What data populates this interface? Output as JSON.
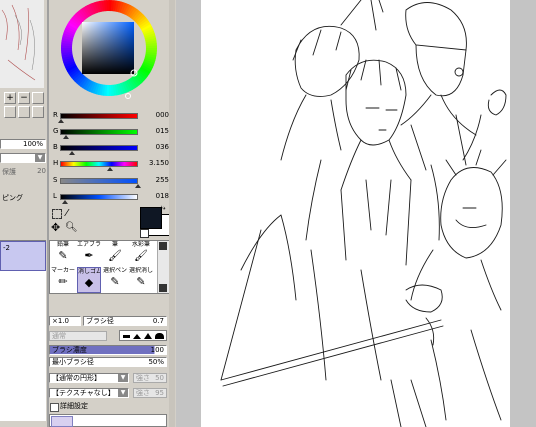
{
  "layer_panel": {
    "opacity_value": "100%",
    "mode_value": "",
    "checkbox_a": "保護",
    "checkbox_b": "20",
    "option_label": "ピング",
    "layer_item_label": "-2"
  },
  "color_sliders": {
    "r": {
      "label": "R",
      "value": "000"
    },
    "g": {
      "label": "G",
      "value": "015"
    },
    "b": {
      "label": "B",
      "value": "036"
    },
    "h": {
      "label": "H",
      "value": "3.150"
    },
    "s": {
      "label": "S",
      "value": "255"
    },
    "l": {
      "label": "L",
      "value": "018"
    }
  },
  "colors": {
    "foreground": "#0f1724",
    "background": "#ffffff",
    "panel": "#d4d0c8",
    "selected_tool": "#c8c0e8"
  },
  "tools": [
    {
      "label": "鉛筆",
      "icon": "pencil-icon",
      "glyph": "✎"
    },
    {
      "label": "エアブラシ",
      "icon": "airbrush-icon",
      "glyph": "✒"
    },
    {
      "label": "筆",
      "icon": "brush-icon",
      "glyph": "🖌"
    },
    {
      "label": "水彩筆",
      "icon": "watercolor-icon",
      "glyph": "🖌"
    },
    {
      "label": "マーカー",
      "icon": "marker-icon",
      "glyph": "✏"
    },
    {
      "label": "消しゴム",
      "icon": "eraser-icon",
      "glyph": "◆"
    },
    {
      "label": "選択ペン",
      "icon": "select-pen-icon",
      "glyph": "✎"
    },
    {
      "label": "選択消し",
      "icon": "select-erase-icon",
      "glyph": "✎"
    }
  ],
  "brush_settings": {
    "scale": "×1.0",
    "size_label": "ブラシ径",
    "size_value": "0.7",
    "mode_label": "通常",
    "density_label": "ブラシ濃度",
    "density_value": "100",
    "min_size_label": "最小ブラシ径",
    "min_size_value": "50%",
    "shape_value": "【通常の円形】",
    "shape_strength": "強さ",
    "shape_num": "50",
    "texture_value": "【テクスチャなし】",
    "texture_strength": "強さ",
    "texture_num": "95",
    "detail_label": "詳細設定"
  }
}
